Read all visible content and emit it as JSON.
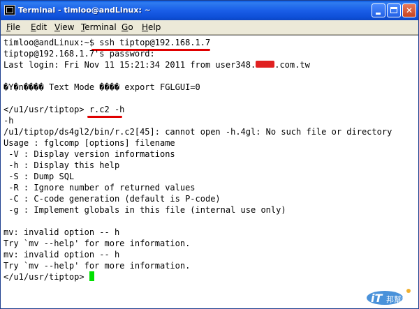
{
  "window": {
    "title": "Terminal - timloo@andLinux: ~",
    "icon": "terminal-icon",
    "controls": [
      "minimize",
      "maximize",
      "close"
    ]
  },
  "menu": {
    "file": "File",
    "edit": "Edit",
    "view": "View",
    "terminal": "Terminal",
    "go": "Go",
    "help": "Help"
  },
  "terminal": {
    "lines": [
      "timloo@andLinux:~$ ssh tiptop@192.168.1.7",
      "tiptop@192.168.1.7's password:",
      "Last login: Fri Nov 11 15:21:34 2011 from user348.",
      "",
      "�Y�n���� Text Mode ���� export FGLGUI=0",
      "",
      "</u1/usr/tiptop> r.c2 -h",
      "-h",
      "/u1/tiptop/ds4gl2/bin/r.c2[45]: cannot open -h.4gl: No such file or directory",
      "Usage : fglcomp [options] filename",
      " -V : Display version informations",
      " -h : Display this help",
      " -S : Dump SQL",
      " -R : Ignore number of returned values",
      " -C : C-code generation (default is P-code)",
      " -g : Implement globals in this file (internal use only)",
      "",
      "mv: invalid option -- h",
      "Try `mv --help' for more information.",
      "mv: invalid option -- h",
      "Try `mv --help' for more information.",
      "</u1/usr/tiptop> "
    ],
    "login_host_suffix": ".com.tw",
    "cursor_color": "#00e000",
    "annotation_color": "#e00000"
  },
  "watermark": {
    "brand": "iT",
    "subtext": "邦幫忙"
  },
  "colors": {
    "titlebar": "#0a58e2",
    "menubar": "#ece9d8",
    "terminal_bg": "#ffffff",
    "terminal_fg": "#000000"
  }
}
